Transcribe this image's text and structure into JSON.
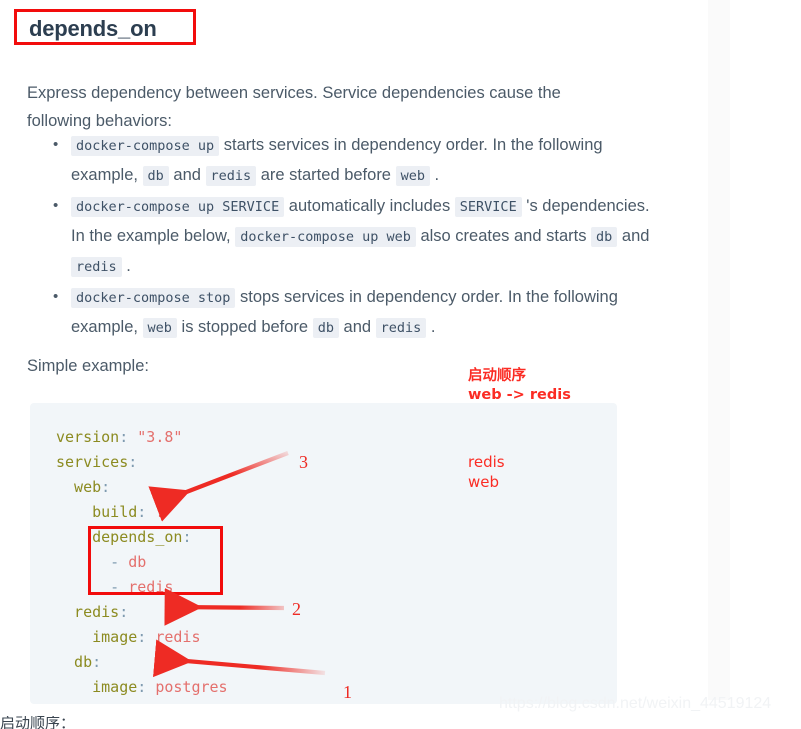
{
  "page": {
    "title": "depends_on",
    "intro": "Express dependency between services. Service dependencies cause the following behaviors:",
    "simple_example_label": "Simple example:",
    "watermark": "https://blog.csdn.net/weixin_44519124",
    "bottom_caption": "启动顺序："
  },
  "behaviors": [
    {
      "parts": [
        {
          "type": "code",
          "text": "docker-compose up"
        },
        {
          "type": "text",
          "text": " starts services in dependency order. In the following example, "
        },
        {
          "type": "code",
          "text": "db"
        },
        {
          "type": "text",
          "text": " and "
        },
        {
          "type": "code",
          "text": "redis"
        },
        {
          "type": "text",
          "text": " are started before "
        },
        {
          "type": "code",
          "text": "web"
        },
        {
          "type": "text",
          "text": " ."
        }
      ]
    },
    {
      "parts": [
        {
          "type": "code",
          "text": "docker-compose up SERVICE"
        },
        {
          "type": "text",
          "text": " automatically includes "
        },
        {
          "type": "code",
          "text": "SERVICE"
        },
        {
          "type": "text",
          "text": " 's dependencies. In the example below, "
        },
        {
          "type": "code",
          "text": "docker-compose up web"
        },
        {
          "type": "text",
          "text": " also creates and starts "
        },
        {
          "type": "code",
          "text": "db"
        },
        {
          "type": "text",
          "text": " and "
        },
        {
          "type": "code",
          "text": "redis"
        },
        {
          "type": "text",
          "text": " ."
        }
      ]
    },
    {
      "parts": [
        {
          "type": "code",
          "text": "docker-compose stop"
        },
        {
          "type": "text",
          "text": " stops services in dependency order. In the following example, "
        },
        {
          "type": "code",
          "text": "web"
        },
        {
          "type": "text",
          "text": " is stopped before "
        },
        {
          "type": "code",
          "text": "db"
        },
        {
          "type": "text",
          "text": " and "
        },
        {
          "type": "code",
          "text": "redis"
        },
        {
          "type": "text",
          "text": " ."
        }
      ]
    }
  ],
  "code_block": {
    "language": "yaml",
    "lines": [
      [
        {
          "c": "k",
          "t": "version"
        },
        {
          "c": "p",
          "t": ":"
        },
        {
          "c": "s",
          "t": " \"3.8\""
        }
      ],
      [
        {
          "c": "k",
          "t": "services"
        },
        {
          "c": "p",
          "t": ":"
        }
      ],
      [
        {
          "c": "k",
          "t": "  web"
        },
        {
          "c": "p",
          "t": ":"
        }
      ],
      [
        {
          "c": "k",
          "t": "    build"
        },
        {
          "c": "p",
          "t": ":"
        },
        {
          "c": "s",
          "t": " ."
        }
      ],
      [
        {
          "c": "k",
          "t": "    depends_on"
        },
        {
          "c": "p",
          "t": ":"
        }
      ],
      [
        {
          "c": "p",
          "t": "      -"
        },
        {
          "c": "s",
          "t": " db"
        }
      ],
      [
        {
          "c": "p",
          "t": "      -"
        },
        {
          "c": "s",
          "t": " redis"
        }
      ],
      [
        {
          "c": "k",
          "t": "  redis"
        },
        {
          "c": "p",
          "t": ":"
        }
      ],
      [
        {
          "c": "k",
          "t": "    image"
        },
        {
          "c": "p",
          "t": ":"
        },
        {
          "c": "s",
          "t": " redis"
        }
      ],
      [
        {
          "c": "k",
          "t": "  db"
        },
        {
          "c": "p",
          "t": ":"
        }
      ],
      [
        {
          "c": "k",
          "t": "    image"
        },
        {
          "c": "p",
          "t": ":"
        },
        {
          "c": "s",
          "t": " postgres"
        }
      ]
    ]
  },
  "annotations": {
    "numbers": [
      "1",
      "2",
      "3"
    ],
    "box_title_color": "#f20c0c",
    "box_depends_on_color": "#f20c0c",
    "arrow_color": "#ee2b24",
    "notes": {
      "order_title": "启动顺序",
      "order_flow": "web -> redis",
      "stack": "redis\nweb",
      "color": "#fb2c24"
    }
  }
}
